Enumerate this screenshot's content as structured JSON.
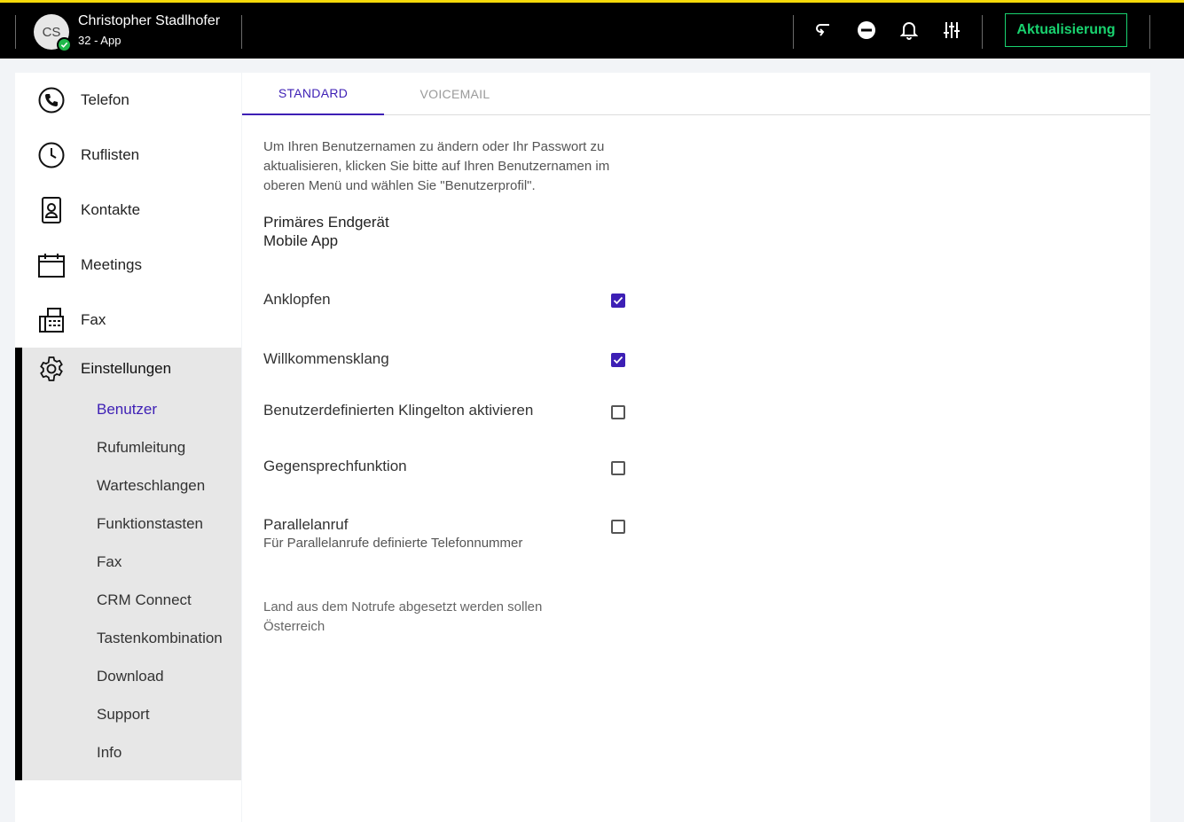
{
  "header": {
    "avatar_initials": "CS",
    "user_name": "Christopher Stadlhofer",
    "user_sub": "32 - App",
    "update_label": "Aktualisierung",
    "icons": [
      "callback-icon",
      "do-not-disturb-icon",
      "bell-icon",
      "sliders-icon"
    ],
    "accent_color": "#19d26f",
    "top_border_color": "#f5d90a"
  },
  "sidebar": {
    "items": [
      {
        "label": "Telefon",
        "icon": "phone-icon"
      },
      {
        "label": "Ruflisten",
        "icon": "clock-icon"
      },
      {
        "label": "Kontakte",
        "icon": "contact-card-icon"
      },
      {
        "label": "Meetings",
        "icon": "calendar-icon"
      },
      {
        "label": "Fax",
        "icon": "fax-icon"
      }
    ],
    "settings": {
      "label": "Einstellungen",
      "icon": "gear-icon",
      "subitems": [
        "Benutzer",
        "Rufumleitung",
        "Warteschlangen",
        "Funktionstasten",
        "Fax",
        "CRM Connect",
        "Tastenkombination",
        "Download",
        "Support",
        "Info"
      ],
      "active": "Benutzer"
    }
  },
  "main": {
    "tabs": [
      {
        "label": "STANDARD",
        "active": true
      },
      {
        "label": "VOICEMAIL",
        "active": false
      }
    ],
    "info_text": "Um Ihren Benutzernamen zu ändern oder Ihr Passwort zu aktualisieren, klicken Sie bitte auf Ihren Benutzernamen im oberen Menü und wählen Sie \"Benutzerprofil\".",
    "primary_device": {
      "title": "Primäres Endgerät",
      "value": "Mobile App"
    },
    "options": [
      {
        "label": "Anklopfen",
        "checked": true
      },
      {
        "label": "Willkommensklang",
        "checked": true
      },
      {
        "label": "Benutzerdefinierten Klingelton aktivieren",
        "checked": false
      },
      {
        "label": "Gegensprechfunktion",
        "checked": false
      },
      {
        "label": "Parallelanruf",
        "sublabel": "Für Parallelanrufe definierte Telefonnummer",
        "checked": false
      }
    ],
    "emergency": {
      "label": "Land aus dem Notrufe abgesetzt werden sollen",
      "value": "Österreich"
    },
    "accent_color": "#3d1fb5"
  }
}
